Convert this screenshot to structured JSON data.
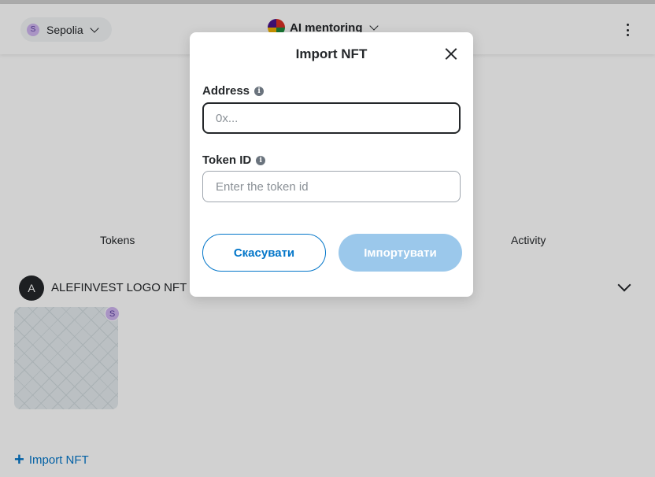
{
  "header": {
    "network": {
      "label": "Sepolia",
      "avatar_letter": "S"
    },
    "account": {
      "name": "AI mentoring"
    },
    "menu_icon": "kebab-menu-icon"
  },
  "tabs": [
    {
      "label": "Tokens"
    },
    {
      "label": "Activity"
    }
  ],
  "collection": {
    "avatar_letter": "A",
    "name": "ALEFINVEST LOGO NFT",
    "nft_badge_letter": "S"
  },
  "import_link": {
    "label": "Import NFT"
  },
  "modal": {
    "title": "Import NFT",
    "address": {
      "label": "Address",
      "placeholder": "0x...",
      "value": ""
    },
    "token_id": {
      "label": "Token ID",
      "placeholder": "Enter the token id",
      "value": ""
    },
    "cancel_label": "Скасувати",
    "import_label": "Імпортувати"
  },
  "colors": {
    "accent": "#0376c9",
    "import_disabled": "#9bc8eb",
    "text": "#24272a"
  }
}
